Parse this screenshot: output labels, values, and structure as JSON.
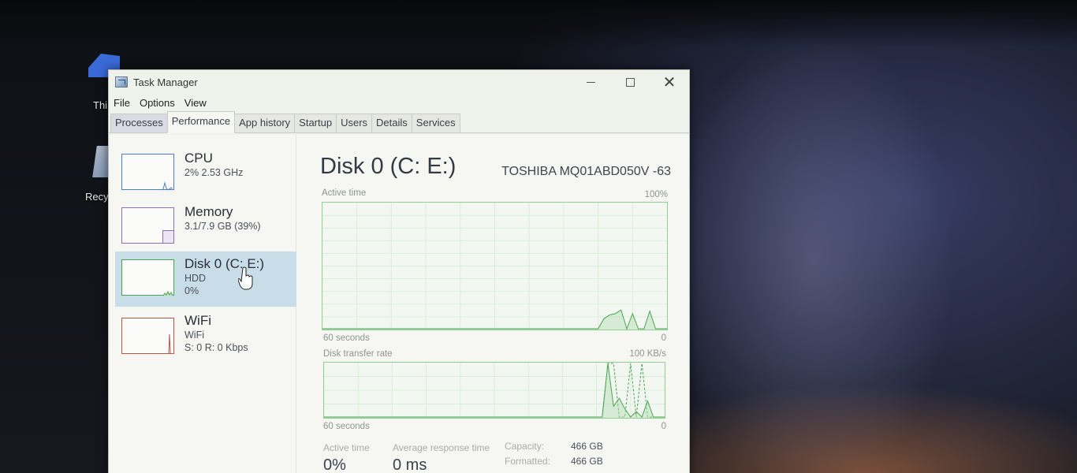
{
  "desktop": {
    "icons": [
      {
        "label": "Thi",
        "name": "this-pc"
      },
      {
        "label": "Recy",
        "name": "recycle-bin"
      }
    ]
  },
  "window": {
    "title": "Task Manager",
    "controls": {
      "minimize": "minimize",
      "maximize": "maximize",
      "close": "close"
    }
  },
  "menu": [
    "File",
    "Options",
    "View"
  ],
  "tabs": [
    {
      "label": "Processes",
      "active": false
    },
    {
      "label": "Performance",
      "active": true
    },
    {
      "label": "App history",
      "active": false
    },
    {
      "label": "Startup",
      "active": false
    },
    {
      "label": "Users",
      "active": false
    },
    {
      "label": "Details",
      "active": false
    },
    {
      "label": "Services",
      "active": false
    }
  ],
  "sidebar": {
    "items": [
      {
        "name": "CPU",
        "line1": "2% 2.53 GHz",
        "line2": "",
        "selected": false,
        "color": "#4f7fc2"
      },
      {
        "name": "Memory",
        "line1": "3.1/7.9 GB (39%)",
        "line2": "",
        "selected": false,
        "color": "#8d6fb2"
      },
      {
        "name": "Disk 0 (C: E:)",
        "line1": "HDD",
        "line2": "0%",
        "selected": true,
        "color": "#4aa350"
      },
      {
        "name": "WiFi",
        "line1": "WiFi",
        "line2": "S: 0 R: 0 Kbps",
        "selected": false,
        "color": "#b25a46"
      }
    ]
  },
  "main": {
    "title": "Disk 0 (C: E:)",
    "model": "TOSHIBA MQ01ABD050V -63",
    "active_time_graph": {
      "label": "Active time",
      "max_label": "100%",
      "x_left": "60 seconds",
      "x_right": "0",
      "values_percent": [
        0,
        0,
        0,
        0,
        0,
        0,
        0,
        0,
        0,
        0,
        0,
        0,
        0,
        0,
        0,
        0,
        0,
        0,
        0,
        0,
        0,
        0,
        0,
        0,
        0,
        0,
        0,
        0,
        0,
        0,
        0,
        0,
        0,
        0,
        0,
        0,
        0,
        0,
        0,
        0,
        0,
        0,
        0,
        0,
        0,
        0,
        0,
        0,
        0,
        8,
        11,
        12,
        15,
        0,
        12,
        0,
        0,
        14,
        0,
        0,
        0
      ]
    },
    "transfer_rate_graph": {
      "label": "Disk transfer rate",
      "max_label": "100 KB/s",
      "x_left": "60 seconds",
      "x_right": "0",
      "read_values_kbps": [
        0,
        0,
        0,
        0,
        0,
        0,
        0,
        0,
        0,
        0,
        0,
        0,
        0,
        0,
        0,
        0,
        0,
        0,
        0,
        0,
        0,
        0,
        0,
        0,
        0,
        0,
        0,
        0,
        0,
        0,
        0,
        0,
        0,
        0,
        0,
        0,
        0,
        0,
        0,
        0,
        0,
        0,
        0,
        0,
        0,
        0,
        0,
        0,
        0,
        0,
        100,
        20,
        35,
        15,
        0,
        10,
        0,
        30,
        0,
        0,
        0
      ],
      "write_values_kbps": [
        0,
        0,
        0,
        0,
        0,
        0,
        0,
        0,
        0,
        0,
        0,
        0,
        0,
        0,
        0,
        0,
        0,
        0,
        0,
        0,
        0,
        0,
        0,
        0,
        0,
        0,
        0,
        0,
        0,
        0,
        0,
        0,
        0,
        0,
        0,
        0,
        0,
        0,
        0,
        0,
        0,
        0,
        0,
        0,
        0,
        0,
        0,
        0,
        0,
        0,
        100,
        100,
        0,
        0,
        100,
        0,
        100,
        0,
        0,
        0,
        0
      ]
    },
    "stats": {
      "active_time_label": "Active time",
      "active_time_value": "0%",
      "avg_response_label": "Average response time",
      "avg_response_value": "0 ms",
      "capacity_label": "Capacity:",
      "capacity_value": "466 GB",
      "formatted_label": "Formatted:",
      "formatted_value": "466 GB"
    }
  },
  "colors": {
    "disk_accent": "#4aa350",
    "graph_border": "#8fcf8f",
    "selected_bg": "#c8dde8"
  }
}
